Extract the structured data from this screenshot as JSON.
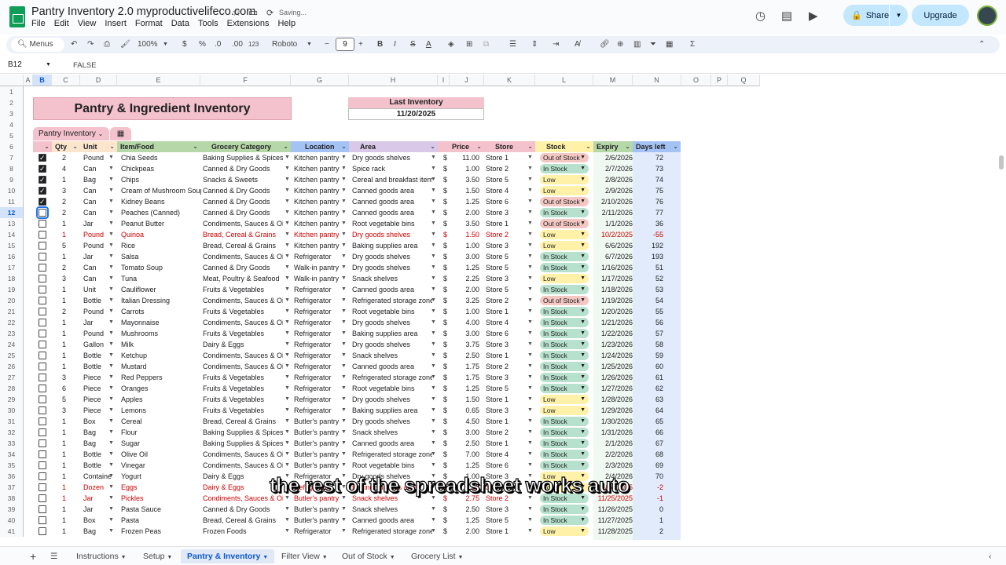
{
  "doc": {
    "title": "Pantry Inventory 2.0 myproductivelifeco.com",
    "saving": "Saving...",
    "menus": [
      "File",
      "Edit",
      "View",
      "Insert",
      "Format",
      "Data",
      "Tools",
      "Extensions",
      "Help"
    ],
    "share": "Share",
    "upgrade": "Upgrade"
  },
  "toolbar": {
    "menus": "Menus",
    "zoom": "100%",
    "currency": "$",
    "percent": "%",
    "dec_dec": ".0",
    "inc_dec": ".00",
    "numfmt": "123",
    "font": "Roboto",
    "fontsize": "9"
  },
  "formula": {
    "cell": "B12",
    "value": "FALSE"
  },
  "columns": [
    "A",
    "B",
    "C",
    "D",
    "E",
    "F",
    "G",
    "H",
    "I",
    "J",
    "K",
    "L",
    "M",
    "N",
    "O",
    "P",
    "Q"
  ],
  "rows": [
    "1",
    "2",
    "3",
    "4",
    "5",
    "6",
    "7",
    "8",
    "9",
    "10",
    "11",
    "12",
    "13",
    "14",
    "15",
    "16",
    "17",
    "18",
    "19",
    "20",
    "21",
    "22",
    "23",
    "24",
    "25",
    "26",
    "27",
    "28",
    "29",
    "30",
    "31",
    "32",
    "33",
    "34",
    "35",
    "36",
    "37",
    "38",
    "39",
    "40",
    "41"
  ],
  "sheet": {
    "title": "Pantry & Ingredient Inventory",
    "last_inventory_label": "Last Inventory",
    "last_inventory_date": "11/20/2025",
    "table_name": "Pantry Inventory"
  },
  "headers": [
    "Qty",
    "Unit",
    "Item/Food",
    "Grocery Category",
    "Location",
    "Area",
    "Price",
    "Store",
    "Stock",
    "Expiry",
    "Days left"
  ],
  "items": [
    {
      "chk": true,
      "qty": "2",
      "unit": "Pound",
      "item": "Chia Seeds",
      "cat": "Baking Supplies & Spices",
      "loc": "Kitchen pantry",
      "area": "Dry goods shelves",
      "price": "11.00",
      "store": "Store 1",
      "stock": "Out of Stock",
      "exp": "2/6/2026",
      "days": "72"
    },
    {
      "chk": true,
      "qty": "4",
      "unit": "Can",
      "item": "Chickpeas",
      "cat": "Canned & Dry Goods",
      "loc": "Kitchen pantry",
      "area": "Spice rack",
      "price": "1.00",
      "store": "Store 2",
      "stock": "In Stock",
      "exp": "2/7/2026",
      "days": "73"
    },
    {
      "chk": true,
      "qty": "1",
      "unit": "Bag",
      "item": "Chips",
      "cat": "Snacks & Sweets",
      "loc": "Kitchen pantry",
      "area": "Cereal and breakfast items",
      "price": "3.50",
      "store": "Store 5",
      "stock": "Low",
      "exp": "2/8/2026",
      "days": "74"
    },
    {
      "chk": true,
      "qty": "3",
      "unit": "Can",
      "item": "Cream of Mushroom Soup",
      "cat": "Canned & Dry Goods",
      "loc": "Kitchen pantry",
      "area": "Canned goods area",
      "price": "1.50",
      "store": "Store 4",
      "stock": "Low",
      "exp": "2/9/2026",
      "days": "75"
    },
    {
      "chk": true,
      "qty": "2",
      "unit": "Can",
      "item": "Kidney Beans",
      "cat": "Canned & Dry Goods",
      "loc": "Kitchen pantry",
      "area": "Canned goods area",
      "price": "1.25",
      "store": "Store 6",
      "stock": "Out of Stock",
      "exp": "2/10/2026",
      "days": "76"
    },
    {
      "chk": false,
      "qty": "2",
      "unit": "Can",
      "item": "Peaches (Canned)",
      "cat": "Canned & Dry Goods",
      "loc": "Kitchen pantry",
      "area": "Canned goods area",
      "price": "2.00",
      "store": "Store 3",
      "stock": "In Stock",
      "exp": "2/11/2026",
      "days": "77"
    },
    {
      "chk": false,
      "qty": "1",
      "unit": "Jar",
      "item": "Peanut Butter",
      "cat": "Condiments, Sauces & Oils",
      "loc": "Kitchen pantry",
      "area": "Root vegetable bins",
      "price": "3.50",
      "store": "Store 1",
      "stock": "Out of Stock",
      "exp": "1/1/2026",
      "days": "36"
    },
    {
      "chk": false,
      "red": true,
      "qty": "1",
      "unit": "Pound",
      "item": "Quinoa",
      "cat": "Bread, Cereal & Grains",
      "loc": "Kitchen pantry",
      "area": "Dry goods shelves",
      "price": "1.50",
      "store": "Store 2",
      "stock": "Low",
      "exp": "10/2/2025",
      "days": "-55"
    },
    {
      "chk": false,
      "qty": "5",
      "unit": "Pound",
      "item": "Rice",
      "cat": "Bread, Cereal & Grains",
      "loc": "Kitchen pantry",
      "area": "Baking supplies area",
      "price": "1.00",
      "store": "Store 3",
      "stock": "Low",
      "exp": "6/6/2026",
      "days": "192"
    },
    {
      "chk": false,
      "qty": "1",
      "unit": "Jar",
      "item": "Salsa",
      "cat": "Condiments, Sauces & Oils",
      "loc": "Refrigerator",
      "area": "Dry goods shelves",
      "price": "3.00",
      "store": "Store 5",
      "stock": "In Stock",
      "exp": "6/7/2026",
      "days": "193"
    },
    {
      "chk": false,
      "qty": "2",
      "unit": "Can",
      "item": "Tomato Soup",
      "cat": "Canned & Dry Goods",
      "loc": "Walk-in pantry",
      "area": "Dry goods shelves",
      "price": "1.25",
      "store": "Store 5",
      "stock": "In Stock",
      "exp": "1/16/2026",
      "days": "51"
    },
    {
      "chk": false,
      "qty": "3",
      "unit": "Can",
      "item": "Tuna",
      "cat": "Meat, Poultry & Seafood",
      "loc": "Walk-in pantry",
      "area": "Snack shelves",
      "price": "2.25",
      "store": "Store 3",
      "stock": "Low",
      "exp": "1/17/2026",
      "days": "52"
    },
    {
      "chk": false,
      "qty": "1",
      "unit": "Unit",
      "item": "Cauliflower",
      "cat": "Fruits & Vegetables",
      "loc": "Refrigerator",
      "area": "Canned goods area",
      "price": "2.00",
      "store": "Store 5",
      "stock": "In Stock",
      "exp": "1/18/2026",
      "days": "53"
    },
    {
      "chk": false,
      "qty": "1",
      "unit": "Bottle",
      "item": "Italian Dressing",
      "cat": "Condiments, Sauces & Oils",
      "loc": "Refrigerator",
      "area": "Refrigerated storage zone",
      "price": "3.25",
      "store": "Store 2",
      "stock": "Out of Stock",
      "exp": "1/19/2026",
      "days": "54"
    },
    {
      "chk": false,
      "qty": "2",
      "unit": "Pound",
      "item": "Carrots",
      "cat": "Fruits & Vegetables",
      "loc": "Refrigerator",
      "area": "Root vegetable bins",
      "price": "1.00",
      "store": "Store 1",
      "stock": "In Stock",
      "exp": "1/20/2026",
      "days": "55"
    },
    {
      "chk": false,
      "qty": "1",
      "unit": "Jar",
      "item": "Mayonnaise",
      "cat": "Condiments, Sauces & Oils",
      "loc": "Refrigerator",
      "area": "Dry goods shelves",
      "price": "4.00",
      "store": "Store 4",
      "stock": "In Stock",
      "exp": "1/21/2026",
      "days": "56"
    },
    {
      "chk": false,
      "qty": "1",
      "unit": "Pound",
      "item": "Mushrooms",
      "cat": "Fruits & Vegetables",
      "loc": "Refrigerator",
      "area": "Baking supplies area",
      "price": "3.00",
      "store": "Store 6",
      "stock": "In Stock",
      "exp": "1/22/2026",
      "days": "57"
    },
    {
      "chk": false,
      "qty": "1",
      "unit": "Gallon",
      "item": "Milk",
      "cat": "Dairy & Eggs",
      "loc": "Refrigerator",
      "area": "Dry goods shelves",
      "price": "3.75",
      "store": "Store 3",
      "stock": "In Stock",
      "exp": "1/23/2026",
      "days": "58"
    },
    {
      "chk": false,
      "qty": "1",
      "unit": "Bottle",
      "item": "Ketchup",
      "cat": "Condiments, Sauces & Oils",
      "loc": "Refrigerator",
      "area": "Snack shelves",
      "price": "2.50",
      "store": "Store 1",
      "stock": "In Stock",
      "exp": "1/24/2026",
      "days": "59"
    },
    {
      "chk": false,
      "qty": "1",
      "unit": "Bottle",
      "item": "Mustard",
      "cat": "Condiments, Sauces & Oils",
      "loc": "Refrigerator",
      "area": "Canned goods area",
      "price": "1.75",
      "store": "Store 2",
      "stock": "In Stock",
      "exp": "1/25/2026",
      "days": "60"
    },
    {
      "chk": false,
      "qty": "3",
      "unit": "Piece",
      "item": "Red Peppers",
      "cat": "Fruits & Vegetables",
      "loc": "Refrigerator",
      "area": "Refrigerated storage zone",
      "price": "1.75",
      "store": "Store 3",
      "stock": "In Stock",
      "exp": "1/26/2026",
      "days": "61"
    },
    {
      "chk": false,
      "qty": "6",
      "unit": "Piece",
      "item": "Oranges",
      "cat": "Fruits & Vegetables",
      "loc": "Refrigerator",
      "area": "Root vegetable bins",
      "price": "1.25",
      "store": "Store 5",
      "stock": "In Stock",
      "exp": "1/27/2026",
      "days": "62"
    },
    {
      "chk": false,
      "qty": "5",
      "unit": "Piece",
      "item": "Apples",
      "cat": "Fruits & Vegetables",
      "loc": "Refrigerator",
      "area": "Dry goods shelves",
      "price": "1.50",
      "store": "Store 1",
      "stock": "Low",
      "exp": "1/28/2026",
      "days": "63"
    },
    {
      "chk": false,
      "qty": "3",
      "unit": "Piece",
      "item": "Lemons",
      "cat": "Fruits & Vegetables",
      "loc": "Refrigerator",
      "area": "Baking supplies area",
      "price": "0.65",
      "store": "Store 3",
      "stock": "Low",
      "exp": "1/29/2026",
      "days": "64"
    },
    {
      "chk": false,
      "qty": "1",
      "unit": "Box",
      "item": "Cereal",
      "cat": "Bread, Cereal & Grains",
      "loc": "Butler's pantry",
      "area": "Dry goods shelves",
      "price": "4.50",
      "store": "Store 1",
      "stock": "In Stock",
      "exp": "1/30/2026",
      "days": "65"
    },
    {
      "chk": false,
      "qty": "1",
      "unit": "Bag",
      "item": "Flour",
      "cat": "Baking Supplies & Spices",
      "loc": "Butler's pantry",
      "area": "Snack shelves",
      "price": "3.00",
      "store": "Store 2",
      "stock": "In Stock",
      "exp": "1/31/2026",
      "days": "66"
    },
    {
      "chk": false,
      "qty": "1",
      "unit": "Bag",
      "item": "Sugar",
      "cat": "Baking Supplies & Spices",
      "loc": "Butler's pantry",
      "area": "Canned goods area",
      "price": "2.50",
      "store": "Store 1",
      "stock": "In Stock",
      "exp": "2/1/2026",
      "days": "67"
    },
    {
      "chk": false,
      "qty": "1",
      "unit": "Bottle",
      "item": "Olive Oil",
      "cat": "Condiments, Sauces & Oils",
      "loc": "Butler's pantry",
      "area": "Refrigerated storage zone",
      "price": "7.00",
      "store": "Store 4",
      "stock": "In Stock",
      "exp": "2/2/2026",
      "days": "68"
    },
    {
      "chk": false,
      "qty": "1",
      "unit": "Bottle",
      "item": "Vinegar",
      "cat": "Condiments, Sauces & Oils",
      "loc": "Butler's pantry",
      "area": "Root vegetable bins",
      "price": "1.25",
      "store": "Store 6",
      "stock": "In Stock",
      "exp": "2/3/2026",
      "days": "69"
    },
    {
      "chk": false,
      "qty": "1",
      "unit": "Containe",
      "item": "Yogurt",
      "cat": "Dairy & Eggs",
      "loc": "Refrigerator",
      "area": "Dry goods shelves",
      "price": "1.00",
      "store": "Store 3",
      "stock": "Low",
      "exp": "2/4/2026",
      "days": "70"
    },
    {
      "chk": false,
      "red": true,
      "qty": "1",
      "unit": "Dozen",
      "item": "Eggs",
      "cat": "Dairy & Eggs",
      "loc": "Refrigerator",
      "area": "Baking supplies area",
      "price": "2.00",
      "store": "Store 5",
      "stock": "Low",
      "exp": "11/24/2025",
      "days": "-2"
    },
    {
      "chk": false,
      "red": true,
      "qty": "1",
      "unit": "Jar",
      "item": "Pickles",
      "cat": "Condiments, Sauces & Oils",
      "loc": "Butler's pantry",
      "area": "Snack shelves",
      "price": "2.75",
      "store": "Store 2",
      "stock": "In Stock",
      "exp": "11/25/2025",
      "days": "-1"
    },
    {
      "chk": false,
      "qty": "1",
      "unit": "Jar",
      "item": "Pasta Sauce",
      "cat": "Canned & Dry Goods",
      "loc": "Butler's pantry",
      "area": "Snack shelves",
      "price": "2.50",
      "store": "Store 3",
      "stock": "In Stock",
      "exp": "11/26/2025",
      "days": "0"
    },
    {
      "chk": false,
      "qty": "1",
      "unit": "Box",
      "item": "Pasta",
      "cat": "Bread, Cereal & Grains",
      "loc": "Butler's pantry",
      "area": "Canned goods area",
      "price": "1.25",
      "store": "Store 5",
      "stock": "In Stock",
      "exp": "11/27/2025",
      "days": "1"
    },
    {
      "chk": false,
      "qty": "1",
      "unit": "Bag",
      "item": "Frozen Peas",
      "cat": "Frozen Foods",
      "loc": "Refrigerator",
      "area": "Refrigerated storage zone",
      "price": "2.00",
      "store": "Store 1",
      "stock": "Low",
      "exp": "11/28/2025",
      "days": "2"
    }
  ],
  "tabs": [
    "Instructions",
    "Setup",
    "Pantry & Inventory",
    "Filter View",
    "Out of Stock",
    "Grocery List"
  ],
  "caption": "the rest of the spreadsheet works auto"
}
